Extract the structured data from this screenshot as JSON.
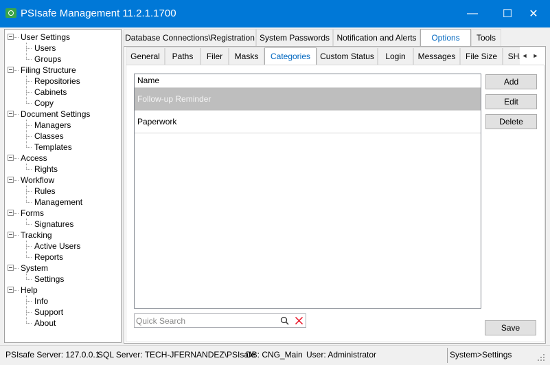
{
  "window": {
    "title": "PSIsafe Management 11.2.1.1700",
    "minimize_glyph": "—",
    "maximize_glyph": "☐",
    "close_glyph": "✕"
  },
  "tree": [
    {
      "label": "User Settings",
      "children": [
        "Users",
        "Groups"
      ]
    },
    {
      "label": "Filing Structure",
      "children": [
        "Repositories",
        "Cabinets",
        "Copy"
      ]
    },
    {
      "label": "Document Settings",
      "children": [
        "Managers",
        "Classes",
        "Templates"
      ]
    },
    {
      "label": "Access",
      "children": [
        "Rights"
      ]
    },
    {
      "label": "Workflow",
      "children": [
        "Rules",
        "Management"
      ]
    },
    {
      "label": "Forms",
      "children": [
        "Signatures"
      ]
    },
    {
      "label": "Tracking",
      "children": [
        "Active Users",
        "Reports"
      ]
    },
    {
      "label": "System",
      "children": [
        "Settings"
      ]
    },
    {
      "label": "Help",
      "children": [
        "Info",
        "Support",
        "About"
      ]
    }
  ],
  "top_tabs": [
    {
      "label": "Database Connections\\Registration",
      "active": false
    },
    {
      "label": "System Passwords",
      "active": false
    },
    {
      "label": "Notification and Alerts",
      "active": false
    },
    {
      "label": "Options",
      "active": true
    },
    {
      "label": "Tools",
      "active": false
    }
  ],
  "sub_tabs": [
    {
      "label": "General",
      "active": false
    },
    {
      "label": "Paths",
      "active": false
    },
    {
      "label": "Filer",
      "active": false
    },
    {
      "label": "Masks",
      "active": false
    },
    {
      "label": "Categories",
      "active": true
    },
    {
      "label": "Custom Status",
      "active": false
    },
    {
      "label": "Login",
      "active": false
    },
    {
      "label": "Messages",
      "active": false
    },
    {
      "label": "File Size",
      "active": false
    },
    {
      "label": "SHA",
      "active": false
    }
  ],
  "tab_scroll": {
    "left": "◄",
    "right": "►"
  },
  "categories": {
    "column_header": "Name",
    "rows": [
      {
        "name": "Follow-up Reminder",
        "selected": true
      },
      {
        "name": "Paperwork",
        "selected": false
      }
    ]
  },
  "buttons": {
    "add": "Add",
    "edit": "Edit",
    "delete": "Delete",
    "save": "Save"
  },
  "search": {
    "placeholder": "Quick Search",
    "value": ""
  },
  "status": {
    "server": "PSIsafe Server: 127.0.0.1",
    "sql_server": "SQL Server: TECH-JFERNANDEZ\\PSIsafe",
    "db": "DB: CNG_Main",
    "user": "User: Administrator",
    "location": "System>Settings"
  },
  "colors": {
    "titlebar": "#0078d7",
    "active_tab_text": "#0067c0",
    "selected_row": "#bebebe",
    "clear_icon": "#e81123"
  }
}
